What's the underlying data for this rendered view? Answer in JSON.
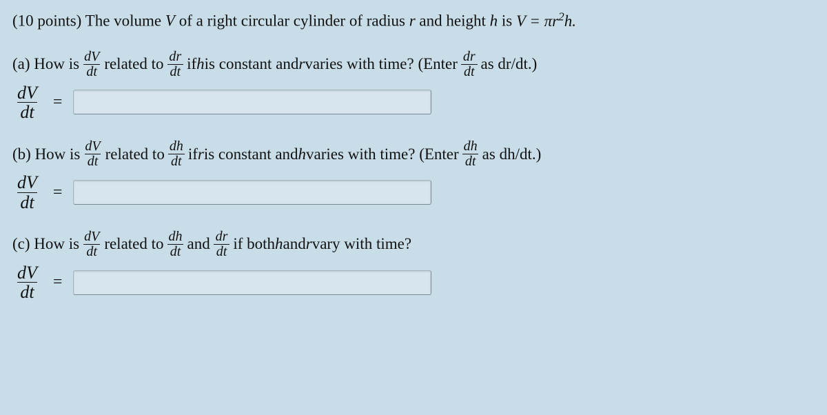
{
  "intro": {
    "points_prefix": "(10 points) ",
    "t1": "The volume ",
    "V": "V",
    "t2": " of a right circular cylinder of radius ",
    "r": "r",
    "t3": " and height ",
    "h": "h",
    "t4": " is ",
    "eq": "V = πr",
    "sup": "2",
    "eq2": "h."
  },
  "a": {
    "label": "(a) How is ",
    "dV": "dV",
    "dt": "dt",
    "mid1": " related to ",
    "dr": "dr",
    "mid2": " if ",
    "h": "h",
    "mid3": " is constant and ",
    "r": "r",
    "mid4": " varies with time? (Enter ",
    "mid5": " as dr/dt.)",
    "ans_dV": "dV",
    "ans_dt": "dt"
  },
  "b": {
    "label": "(b) How is ",
    "dV": "dV",
    "dt": "dt",
    "mid1": " related to ",
    "dh": "dh",
    "mid2": " if ",
    "r": "r",
    "mid3": " is constant and ",
    "h": "h",
    "mid4": " varies with time? (Enter ",
    "mid5": " as dh/dt.)",
    "ans_dV": "dV",
    "ans_dt": "dt"
  },
  "c": {
    "label": "(c) How is ",
    "dV": "dV",
    "dt": "dt",
    "mid1": " related to ",
    "dh": "dh",
    "mid2": " and ",
    "dr": "dr",
    "mid3": " if both ",
    "h": "h",
    "mid4": " and ",
    "r": "r",
    "mid5": " vary with time?",
    "ans_dV": "dV",
    "ans_dt": "dt"
  },
  "equals": "="
}
